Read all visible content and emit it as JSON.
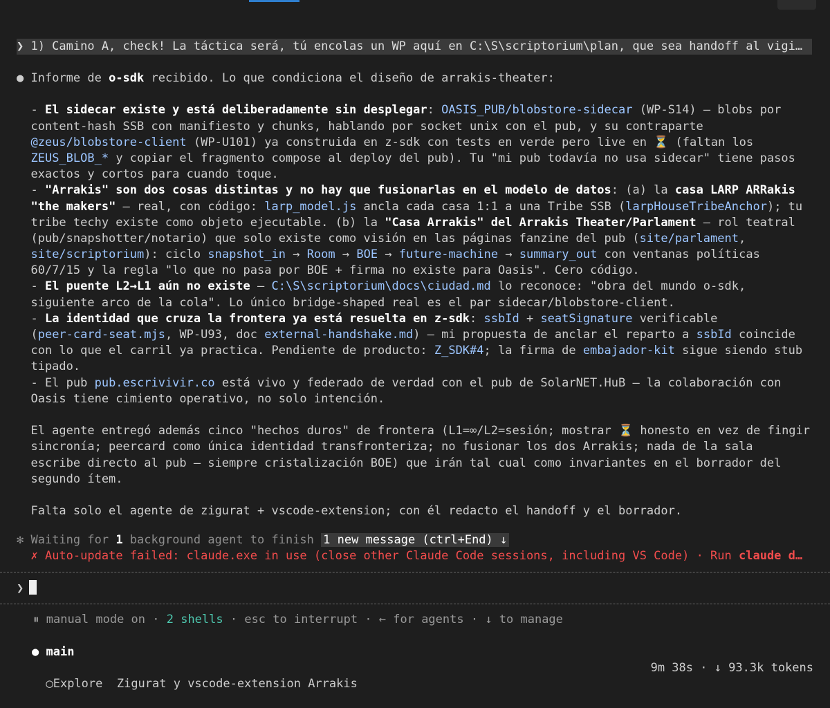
{
  "prompt_echo": "❯ 1) Camino A, check! La táctica será, tú encolas un WP aquí en C:\\S\\scriptorium\\plan, que sea handoff al vigi…",
  "report": {
    "bullet": "●",
    "intro_pre": " Informe de ",
    "intro_bold": "o-sdk",
    "intro_post": " recibido. Lo que condiciona el diseño de arrakis-theater:",
    "l1_dash": "  - ",
    "l1_bold": "El sidecar existe y está deliberadamente sin desplegar",
    "l1_t1": ": ",
    "l1_c1": "OASIS_PUB/blobstore-sidecar",
    "l1_t2": " (WP-S14) — blobs por",
    "l2": "  content-hash SSB con manifiesto y chunks, hablando por socket unix con el pub, y su contraparte",
    "l3_pre": "  ",
    "l3_c1": "@zeus/blobstore-client",
    "l3_post": " (WP-U101) ya construida en z-sdk con tests en verde pero live en ⏳ (faltan los",
    "l4_pre": "  ",
    "l4_c1": "ZEUS_BLOB_*",
    "l4_post": " y copiar el fragmento compose al deploy del pub). Tu \"mi pub todavía no usa sidecar\" tiene pasos",
    "l5": "  exactos y cortos para cuando toque.",
    "l6_dash": "  - ",
    "l6_bold": "\"Arrakis\" son dos cosas distintas y no hay que fusionarlas en el modelo de datos",
    "l6_t1": ": (a) la ",
    "l6_bold2": "casa LARP ARRakis",
    "l7_pre": "  ",
    "l7_bold": "\"the makers\"",
    "l7_t1": " — real, con código: ",
    "l7_c1": "larp_model.js",
    "l7_t2": " ancla cada casa 1:1 a una Tribe SSB (",
    "l7_c2": "larpHouseTribeAnchor",
    "l7_t3": "); tu",
    "l8_pre": "  tribe techy existe como objeto ejecutable. (b) la ",
    "l8_bold": "\"Casa Arrakis\" del Arrakis Theater/Parlament",
    "l8_post": " — rol teatral",
    "l9_pre": "  (pub/snapshotter/notario) que solo existe como visión en las páginas fanzine del pub (",
    "l9_c1": "site/parlament",
    "l9_post": ",",
    "l10_pre": "  ",
    "l10_c1": "site/scriptorium",
    "l10_t1": "): ciclo ",
    "l10_c2": "snapshot_in",
    "l10_t2": " → ",
    "l10_c3": "Room",
    "l10_t3": " → ",
    "l10_c4": "BOE",
    "l10_t4": " → ",
    "l10_c5": "future-machine",
    "l10_t5": " → ",
    "l10_c6": "summary_out",
    "l10_t6": " con ventanas políticas",
    "l11": "  60/7/15 y la regla \"lo que no pasa por BOE + firma no existe para Oasis\". Cero código.",
    "l12_dash": "  - ",
    "l12_bold": "El puente L2→L1 aún no existe",
    "l12_t1": " — ",
    "l12_c1": "C:\\S\\scriptorium\\docs\\ciudad.md",
    "l12_t2": " lo reconoce: \"obra del mundo o-sdk,",
    "l13": "  siguiente arco de la cola\". Lo único bridge-shaped real es el par sidecar/blobstore-client.",
    "l14_dash": "  - ",
    "l14_bold": "La identidad que cruza la frontera ya está resuelta en z-sdk",
    "l14_t1": ": ",
    "l14_c1": "ssbId",
    "l14_t2": " + ",
    "l14_c2": "seatSignature",
    "l14_t3": " verificable",
    "l15_pre": "  (",
    "l15_c1": "peer-card-seat.mjs",
    "l15_t1": ", WP-U93, doc ",
    "l15_c2": "external-handshake.md",
    "l15_t2": ") — mi propuesta de anclar el reparto a ",
    "l15_c3": "ssbId",
    "l15_t3": " coincide",
    "l16_pre": "  con lo que el carril ya practica. Pendiente de producto: ",
    "l16_c1": "Z_SDK#4",
    "l16_t1": "; la firma de ",
    "l16_c2": "embajador-kit",
    "l16_t2": " sigue siendo stub",
    "l17": "  tipado.",
    "l18_pre": "  - El pub ",
    "l18_c1": "pub.escrivivir.co",
    "l18_post": " está vivo y federado de verdad con el pub de SolarNET.HuB — la colaboración con",
    "l19": "  Oasis tiene cimiento operativo, no solo intención.",
    "l20": "",
    "l21": "  El agente entregó además cinco \"hechos duros\" de frontera (L1=∞/L2=sesión; mostrar ⏳ honesto en vez de fingir",
    "l22": "  sincronía; peercard como única identidad transfronteriza; no fusionar los dos Arrakis; nada de la sala",
    "l23": "  escribe directo al pub — siempre cristalización BOE) que irán tal cual como invariantes en el borrador del",
    "l24": "  segundo ítem.",
    "l25": "",
    "l26": "  Falta solo el agente de zigurat + vscode-extension; con él redacto el handoff y el borrador."
  },
  "status": {
    "spinner": "✻",
    "waiting_pre": " Waiting for ",
    "waiting_count": "1",
    "waiting_post": " background agent to finish ",
    "new_message": "1 new message (ctrl+End) ↓",
    "error_icon": "✗",
    "error_text": " Auto-update failed: claude.exe in use (close other Claude Code sessions, including VS Code) · Run ",
    "error_cmd": "claude d…"
  },
  "input": {
    "prompt_symbol": "❯"
  },
  "footer": {
    "mode_icon": "⏸",
    "mode_text": " manual mode on · ",
    "shells": "2 shells",
    "rest": " · esc to interrupt · ← for agents · ↓ to manage"
  },
  "agents": {
    "main_bullet": "●",
    "main_label": " main",
    "explore_icon": "◯",
    "explore_label": "Explore  Zigurat y vscode-extension Arrakis",
    "explore_stats": "9m 38s · ↓ 93.3k tokens"
  }
}
